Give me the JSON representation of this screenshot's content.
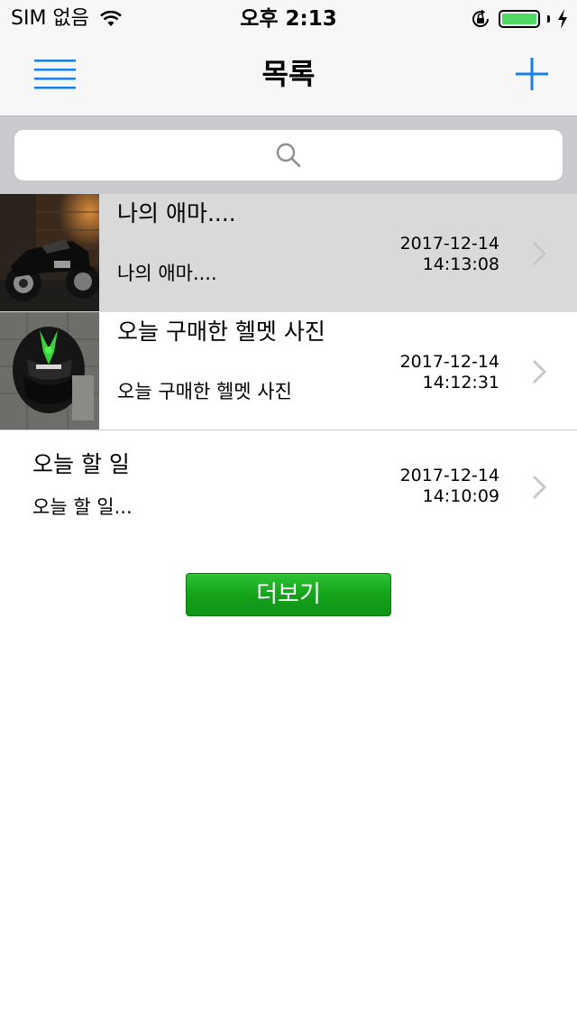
{
  "status_bar": {
    "carrier": "SIM 없음",
    "time": "오후 2:13",
    "battery_color": "#4cd964"
  },
  "nav": {
    "title": "목록",
    "menu_icon": "hamburger-menu-icon",
    "add_icon": "plus-icon",
    "accent_color": "#1a7fe8"
  },
  "search": {
    "placeholder": "",
    "icon": "search-icon"
  },
  "list": {
    "items": [
      {
        "title": "나의 애마....",
        "subtitle": "나의 애마....",
        "date": "2017-12-14",
        "time": "14:13:08",
        "thumbnail": "motorcycle-photo",
        "selected": true
      },
      {
        "title": "오늘 구매한 헬멧 사진",
        "subtitle": "오늘 구매한 헬멧 사진",
        "date": "2017-12-14",
        "time": "14:12:31",
        "thumbnail": "helmet-photo",
        "selected": false
      },
      {
        "title": "오늘 할 일",
        "subtitle": "오늘 할 일...",
        "date": "2017-12-14",
        "time": "14:10:09",
        "thumbnail": null,
        "selected": false
      }
    ]
  },
  "more_button": {
    "label": "더보기",
    "color": "#12a119"
  }
}
